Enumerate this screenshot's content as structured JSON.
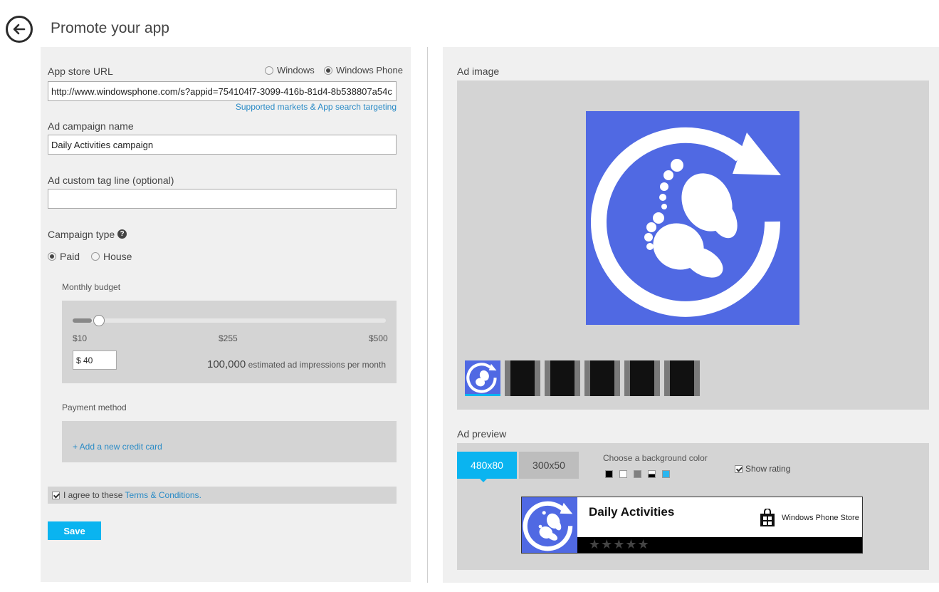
{
  "header": {
    "title": "Promote your app"
  },
  "form": {
    "app_url": {
      "label": "App store URL",
      "value": "http://www.windowsphone.com/s?appid=754104f7-3099-416b-81d4-8b538807a54c",
      "platform_options": [
        "Windows",
        "Windows Phone"
      ],
      "selected_platform": "Windows Phone",
      "targeting_link": "Supported markets & App search targeting"
    },
    "campaign_name": {
      "label": "Ad campaign name",
      "value": "Daily Activities campaign"
    },
    "tag_line": {
      "label": "Ad custom tag line (optional)",
      "value": "",
      "placeholder": ""
    },
    "campaign_type": {
      "label": "Campaign type",
      "help_glyph": "?",
      "options": [
        "Paid",
        "House"
      ],
      "selected": "Paid"
    },
    "budget": {
      "label": "Monthly budget",
      "min_label": "$10",
      "mid_label": "$255",
      "max_label": "$500",
      "slider_min": 10,
      "slider_max": 500,
      "slider_value": 40,
      "amount": "$ 40",
      "impressions_count": "100,000",
      "impressions_text": "estimated ad impressions per month"
    },
    "payment": {
      "label": "Payment method",
      "add_card_link": "+ Add a new credit card"
    },
    "terms": {
      "checked": true,
      "prefix": "I agree to these ",
      "link": "Terms & Conditions",
      "suffix": "."
    },
    "save_label": "Save"
  },
  "ad_image": {
    "label": "Ad image",
    "main_icon": "footprints-refresh-icon",
    "icon_color": "#5069e3",
    "thumbnail_count": 6,
    "selected_thumbnail": 0
  },
  "ad_preview": {
    "label": "Ad preview",
    "sizes": [
      "480x80",
      "300x50"
    ],
    "selected_size": "480x80",
    "bg_color_label": "Choose a background color",
    "bg_colors": [
      "#000000",
      "#ffffff",
      "#808080",
      "#000000/#ffffff",
      "#29b6f0"
    ],
    "show_rating": {
      "checked": true,
      "label": "Show rating"
    },
    "banner": {
      "app_name": "Daily Activities",
      "store_name": "Windows Phone Store",
      "stars": "★★★★★"
    }
  },
  "colors": {
    "accent": "#0ab4f0",
    "link": "#2a8bc6",
    "panel_bg": "#f0f0f0",
    "box_bg": "#d4d4d4"
  }
}
